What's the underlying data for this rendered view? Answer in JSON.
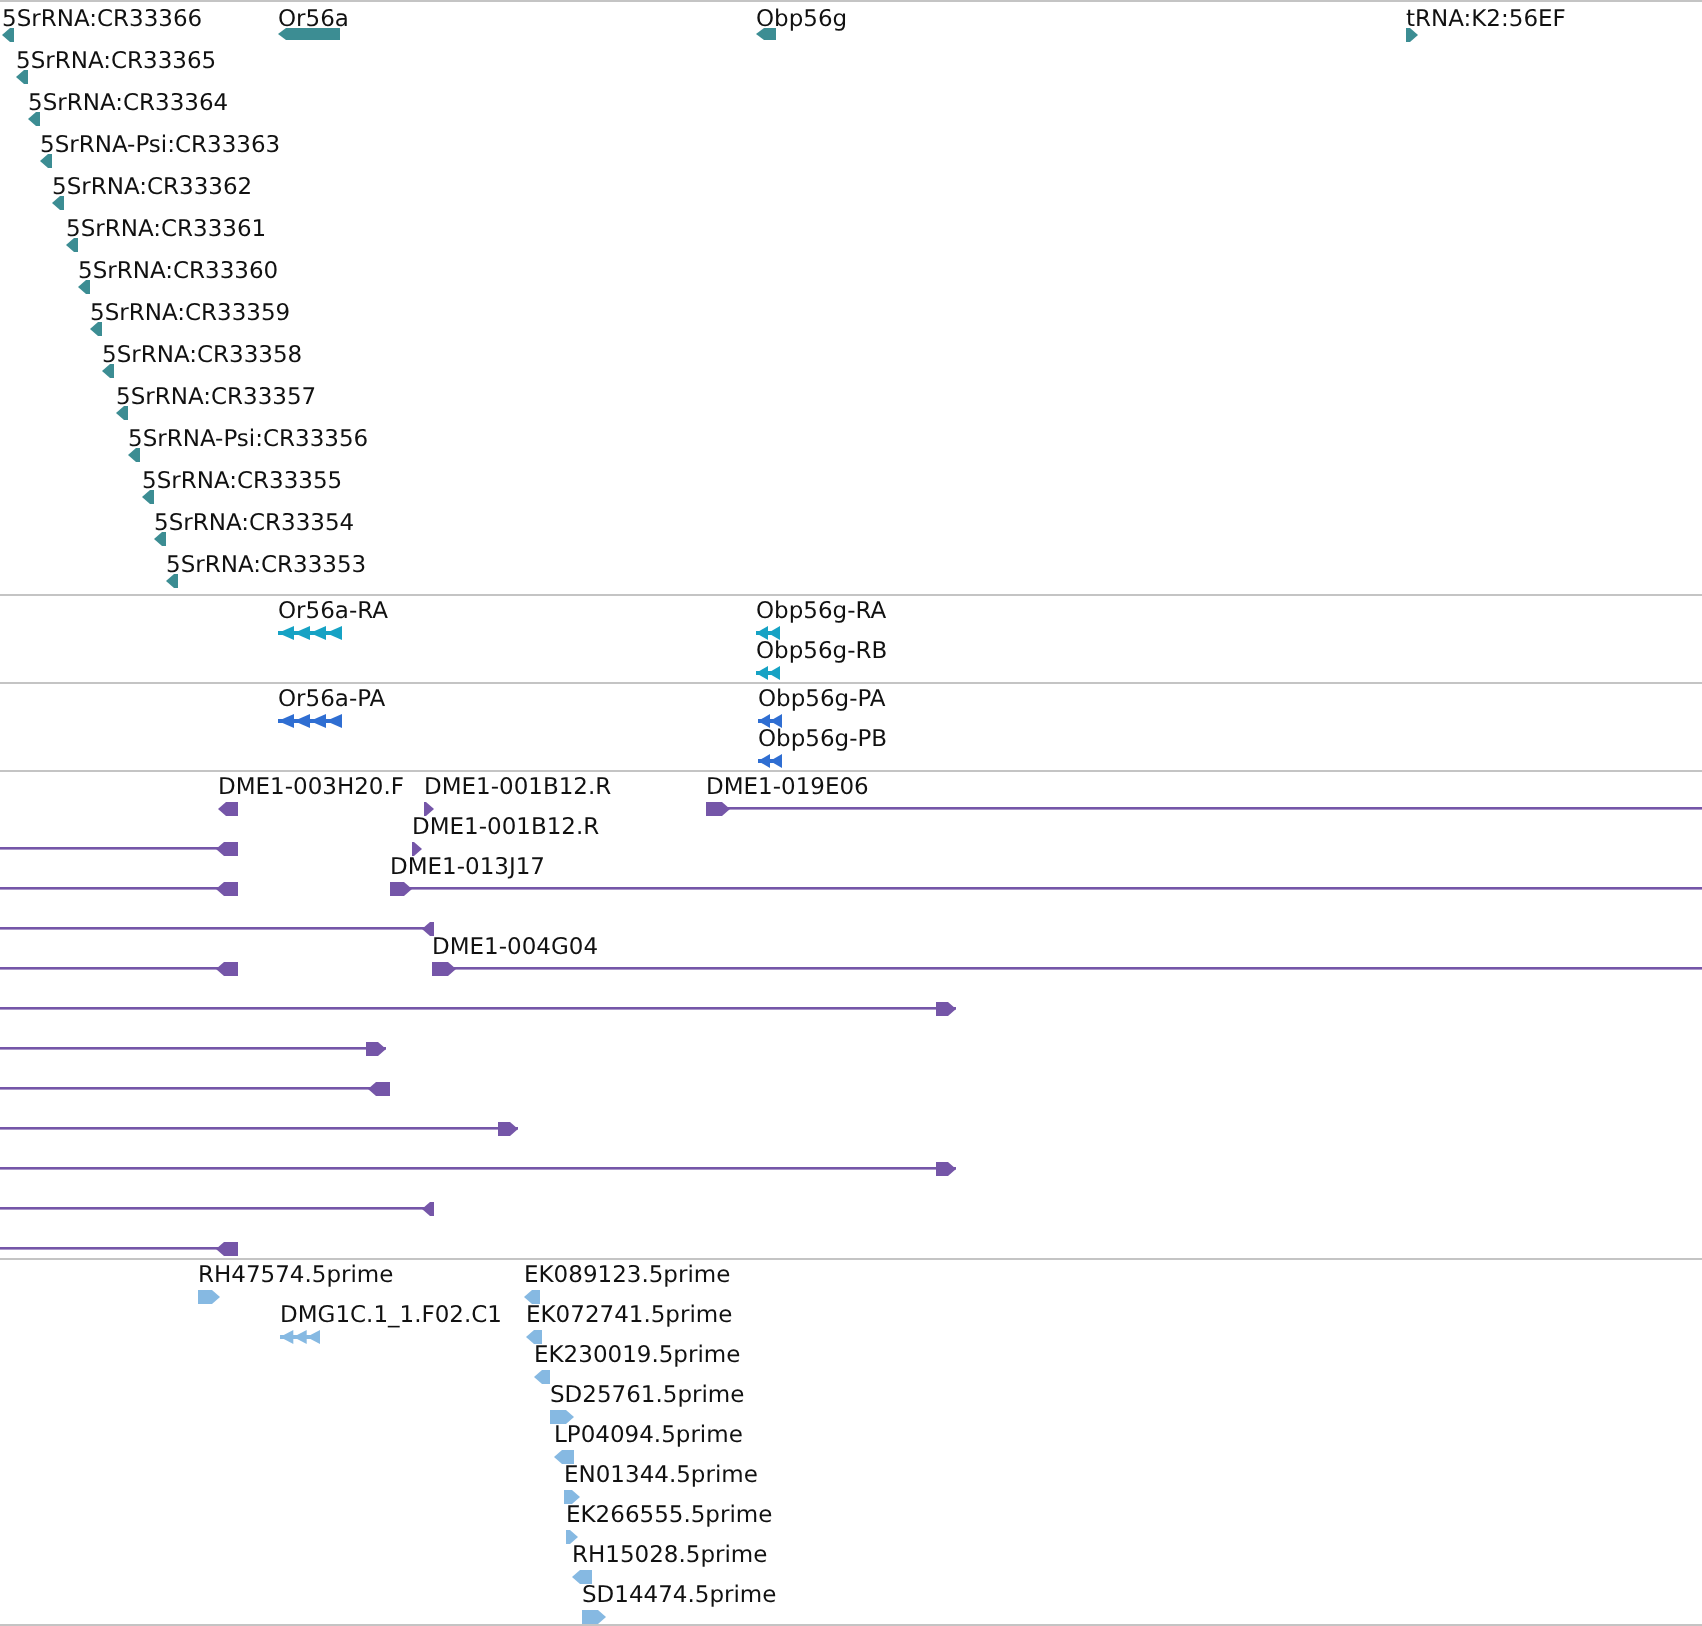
{
  "tracks": [
    {
      "kind": "gene",
      "features": [
        {
          "label": "5SrRNA:CR33366",
          "reverse": true
        },
        {
          "label": "Or56a",
          "reverse": true
        },
        {
          "label": "Obp56g",
          "reverse": true
        },
        {
          "label": "tRNA:K2:56EF",
          "reverse": false
        },
        {
          "label": "5SrRNA:CR33365",
          "reverse": true
        },
        {
          "label": "5SrRNA:CR33364",
          "reverse": true
        },
        {
          "label": "5SrRNA-Psi:CR33363",
          "reverse": true
        },
        {
          "label": "5SrRNA:CR33362",
          "reverse": true
        },
        {
          "label": "5SrRNA:CR33361",
          "reverse": true
        },
        {
          "label": "5SrRNA:CR33360",
          "reverse": true
        },
        {
          "label": "5SrRNA:CR33359",
          "reverse": true
        },
        {
          "label": "5SrRNA:CR33358",
          "reverse": true
        },
        {
          "label": "5SrRNA:CR33357",
          "reverse": true
        },
        {
          "label": "5SrRNA-Psi:CR33356",
          "reverse": true
        },
        {
          "label": "5SrRNA:CR33355",
          "reverse": true
        },
        {
          "label": "5SrRNA:CR33354",
          "reverse": true
        },
        {
          "label": "5SrRNA:CR33353",
          "reverse": true
        }
      ]
    },
    {
      "kind": "transcript",
      "features": [
        {
          "label": "Or56a-RA",
          "reverse": true
        },
        {
          "label": "Obp56g-RA",
          "reverse": true
        },
        {
          "label": "Obp56g-RB",
          "reverse": true
        }
      ]
    },
    {
      "kind": "protein",
      "features": [
        {
          "label": "Or56a-PA",
          "reverse": true
        },
        {
          "label": "Obp56g-PA",
          "reverse": true
        },
        {
          "label": "Obp56g-PB",
          "reverse": true
        }
      ]
    },
    {
      "kind": "clone",
      "features": [
        {
          "label": "DME1-003H20.F",
          "reverse": true
        },
        {
          "label": "DME1-001B12.R",
          "reverse": false
        },
        {
          "label": "DME1-019E06",
          "reverse": false
        },
        {
          "reverse": true
        },
        {
          "label": "DME1-001B12.R",
          "reverse": false
        },
        {
          "reverse": true
        },
        {
          "label": "DME1-013J17",
          "reverse": false
        },
        {
          "reverse": true
        },
        {
          "reverse": true
        },
        {
          "label": "DME1-004G04",
          "reverse": false
        },
        {
          "reverse": false
        },
        {
          "reverse": false
        },
        {
          "reverse": true
        },
        {
          "reverse": false
        },
        {
          "reverse": false
        },
        {
          "reverse": true
        },
        {
          "reverse": true
        }
      ]
    },
    {
      "kind": "est",
      "features": [
        {
          "label": "RH47574.5prime",
          "reverse": false
        },
        {
          "label": "EK089123.5prime",
          "reverse": true
        },
        {
          "label": "DMG1C.1_1.F02.C1",
          "reverse": true
        },
        {
          "label": "EK072741.5prime",
          "reverse": true
        },
        {
          "label": "EK230019.5prime",
          "reverse": true
        },
        {
          "label": "SD25761.5prime",
          "reverse": false
        },
        {
          "label": "LP04094.5prime",
          "reverse": true
        },
        {
          "label": "EN01344.5prime",
          "reverse": false
        },
        {
          "label": "EK266555.5prime",
          "reverse": false
        },
        {
          "label": "RH15028.5prime",
          "reverse": true
        },
        {
          "label": "SD14474.5prime",
          "reverse": false
        }
      ]
    }
  ]
}
